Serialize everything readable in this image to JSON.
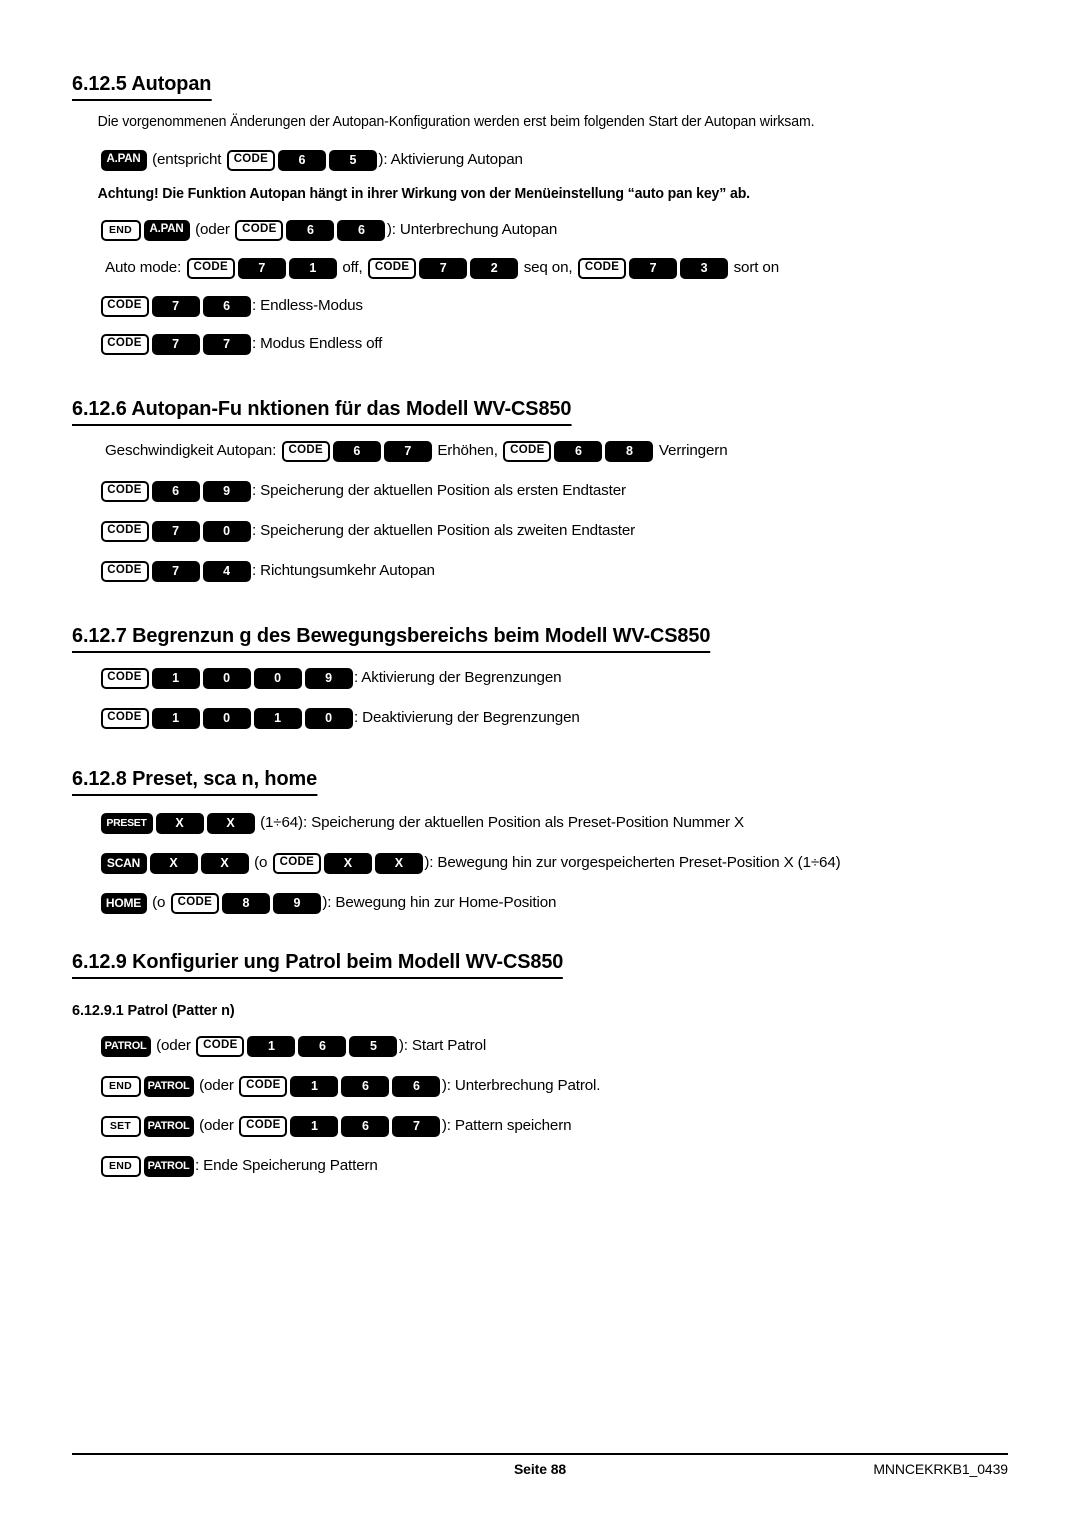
{
  "document": {
    "language": "de",
    "page_label": "Seite 88",
    "doc_code": "MNNCEKRKB1_0439"
  },
  "sections": [
    {
      "heading": "6.12.5 Autopan",
      "intro": "Die vorgenommenen Änderungen der Autopan-Konfiguration werden erst beim folgenden Start der Autopan wirksam.",
      "warning": "Achtung! Die Funktion Autopan hängt in ihrer Wirkung von der Menüeinstellung “auto pan key” ab.",
      "lines": {
        "l1_pre": "",
        "l1_mid": " (entspricht ",
        "l1_post": "): Aktivierung Autopan",
        "l2_mid": " (oder ",
        "l2_post": "): Unterbrechung Autopan",
        "l3_label": "Auto mode: ",
        "l3_off": " off, ",
        "l3_seq": " seq on, ",
        "l3_sort": " sort on",
        "l4_post": ": Endless-Modus",
        "l5_post": ": Modus Endless off"
      },
      "keys": {
        "apan": "A.PAN",
        "code": "CODE",
        "end": "END",
        "k65": [
          "6",
          "5"
        ],
        "k66": [
          "6",
          "6"
        ],
        "k71": [
          "7",
          "1"
        ],
        "k72": [
          "7",
          "2"
        ],
        "k73": [
          "7",
          "3"
        ],
        "k76": [
          "7",
          "6"
        ],
        "k77": [
          "7",
          "7"
        ]
      }
    },
    {
      "heading": "6.12.6 Autopan-Fu nktionen für das Modell WV-CS850",
      "lines": {
        "l1_label": "Geschwindigkeit Autopan: ",
        "l1_mid": " Erhöhen, ",
        "l1_post": " Verringern",
        "l2_post": ": Speicherung der aktuellen Position als ersten Endtaster",
        "l3_post": ": Speicherung der aktuellen Position als zweiten Endtaster",
        "l4_post": ": Richtungsumkehr Autopan"
      },
      "keys": {
        "code": "CODE",
        "k67": [
          "6",
          "7"
        ],
        "k68": [
          "6",
          "8"
        ],
        "k69": [
          "6",
          "9"
        ],
        "k70": [
          "7",
          "0"
        ],
        "k74": [
          "7",
          "4"
        ]
      }
    },
    {
      "heading": "6.12.7 Begrenzun g des Bewegungsbereichs beim Modell WV-CS850",
      "lines": {
        "l1_post": ": Aktivierung der Begrenzungen",
        "l2_post": ": Deaktivierung der Begrenzungen"
      },
      "keys": {
        "code": "CODE",
        "k1009": [
          "1",
          "0",
          "0",
          "9"
        ],
        "k1010": [
          "1",
          "0",
          "1",
          "0"
        ]
      }
    },
    {
      "heading": "6.12.8 Preset, sca n, home",
      "lines": {
        "l1_post": " (1÷64): Speicherung der aktuellen Position als Preset-Position Nummer X",
        "l2_mid": " (o ",
        "l2_post": "): Bewegung hin zur vorgespeicherten Preset-Position X (1÷64)",
        "l3_mid": " (o ",
        "l3_post": "): Bewegung hin zur Home-Position"
      },
      "keys": {
        "preset": "PRESET",
        "scan": "SCAN",
        "home": "HOME",
        "code": "CODE",
        "xx": [
          "X",
          "X"
        ],
        "k89": [
          "8",
          "9"
        ]
      }
    },
    {
      "heading": "6.12.9 Konfigurier ung Patrol beim Modell WV-CS850",
      "subheading": "6.12.9.1 Patrol (Patter n)",
      "lines": {
        "l1_mid": " (oder ",
        "l1_post": "): Start Patrol",
        "l2_mid": " (oder ",
        "l2_post": "): Unterbrechung Patrol.",
        "l3_mid": " (oder ",
        "l3_post": "): Pattern speichern",
        "l4_post": ": Ende Speicherung Pattern"
      },
      "keys": {
        "patrol": "PATROL",
        "code": "CODE",
        "end": "END",
        "set": "SET",
        "k165": [
          "1",
          "6",
          "5"
        ],
        "k166": [
          "1",
          "6",
          "6"
        ],
        "k167": [
          "1",
          "6",
          "7"
        ]
      }
    }
  ]
}
